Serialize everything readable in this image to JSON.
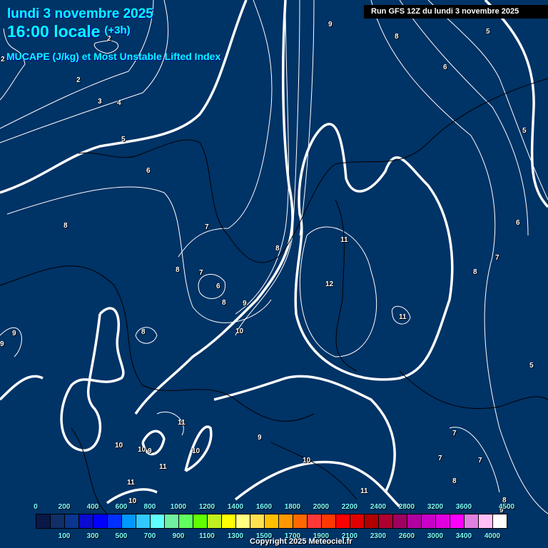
{
  "header": {
    "date": "lundi 3 novembre 2025",
    "time": "16:00 locale",
    "offset": "(+3h)",
    "product": "MUCAPE (J/kg) et Most Unstable Lifted Index",
    "run": "Run GFS 12Z du lundi 3 novembre 2025"
  },
  "contour_labels": [
    "2",
    "2",
    "2",
    "3",
    "4",
    "5",
    "6",
    "8",
    "7",
    "8",
    "7",
    "6",
    "8",
    "9",
    "10",
    "8",
    "9",
    "9",
    "8",
    "11",
    "12",
    "11",
    "9",
    "8",
    "5",
    "6",
    "5",
    "6",
    "7",
    "8",
    "5",
    "11",
    "9",
    "10",
    "10",
    "9",
    "10",
    "11",
    "11",
    "10",
    "10",
    "7",
    "7",
    "7",
    "8",
    "11",
    "8",
    "9"
  ],
  "colorbar": {
    "colors": [
      "#0a1848",
      "#0f2f66",
      "#0a3590",
      "#0a0ad0",
      "#0000ff",
      "#0030ff",
      "#0098ff",
      "#30c8ff",
      "#60ffff",
      "#70f0a0",
      "#60ff60",
      "#60ff00",
      "#c0f020",
      "#ffff00",
      "#ffff80",
      "#ffe050",
      "#ffc000",
      "#ff9800",
      "#ff6800",
      "#ff3838",
      "#ff3800",
      "#ff0000",
      "#e00000",
      "#b00000",
      "#b00030",
      "#a00060",
      "#b000a0",
      "#c800c8",
      "#e000e0",
      "#ff00ff",
      "#e080e0",
      "#ffc0f8",
      "#ffffff"
    ],
    "top_labels": [
      "0",
      "200",
      "400",
      "600",
      "800",
      "1000",
      "1200",
      "1400",
      "1600",
      "1800",
      "2000",
      "2200",
      "2400",
      "2800",
      "3200",
      "3600",
      "4500"
    ],
    "bottom_labels": [
      "100",
      "300",
      "500",
      "700",
      "900",
      "1100",
      "1300",
      "1500",
      "1700",
      "1900",
      "2100",
      "2300",
      "2600",
      "3000",
      "3400",
      "4000"
    ]
  },
  "copyright": "Copyright 2025 Meteociel.fr"
}
